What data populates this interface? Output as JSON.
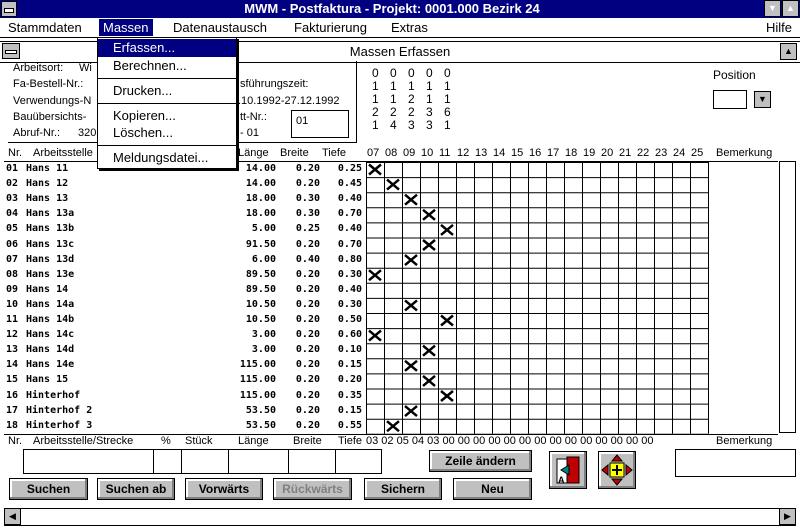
{
  "window": {
    "title": "MWM - Postfaktura  -  Projekt: 0001.000 Bezirk 24"
  },
  "menubar": {
    "items": [
      {
        "label": "Stammdaten"
      },
      {
        "label": "Massen"
      },
      {
        "label": "Datenaustausch"
      },
      {
        "label": "Fakturierung"
      },
      {
        "label": "Extras"
      }
    ],
    "help": "Hilfe"
  },
  "menu_massen": {
    "items": [
      "Erfassen...",
      "Berechnen...",
      "Drucken...",
      "Kopieren...",
      "Löschen...",
      "Meldungsdatei..."
    ]
  },
  "child": {
    "title": "Massen Erfassen"
  },
  "info": {
    "arbeitsort_label": "Arbeitsort:",
    "arbeitsort_value": "Wi",
    "fabestell_label": "Fa-Bestell-Nr.:",
    "verwendung_label": "Verwendungs-N",
    "bauuebersicht_label": "Bauübersichts-",
    "abruf_label": "Abruf-Nr.:",
    "abruf_value": "320",
    "ausfuehrung_label": "sführungszeit:",
    "ausfuehrung_value": ".10.1992-27.12.1992",
    "blatt_label": "tt-Nr.:",
    "blatt_value": "- 01",
    "blatt_box": "01"
  },
  "digits": {
    "rows": [
      [
        "0",
        "0",
        "0",
        "0",
        "0"
      ],
      [
        "1",
        "1",
        "1",
        "1",
        "1"
      ],
      [
        "1",
        "1",
        "2",
        "1",
        "1"
      ],
      [
        "2",
        "2",
        "2",
        "3",
        "6"
      ],
      [
        "1",
        "4",
        "3",
        "3",
        "1"
      ]
    ]
  },
  "position": {
    "label": "Position",
    "value": ""
  },
  "table": {
    "headers": {
      "nr": "Nr.",
      "arbeitsstelle": "Arbeitsstelle",
      "laenge": "Länge",
      "breite": "Breite",
      "tiefe": "Tiefe",
      "bemerkung": "Bemerkung"
    },
    "day_columns": [
      "07",
      "08",
      "09",
      "10",
      "11",
      "12",
      "13",
      "14",
      "15",
      "16",
      "17",
      "18",
      "19",
      "20",
      "21",
      "22",
      "23",
      "24",
      "25"
    ],
    "rows": [
      {
        "nr": "01",
        "name": "Hans 11",
        "laenge": "14.00",
        "breite": "0.20",
        "tiefe": "0.25",
        "mark": 0
      },
      {
        "nr": "02",
        "name": "Hans 12",
        "laenge": "14.00",
        "breite": "0.20",
        "tiefe": "0.45",
        "mark": 1
      },
      {
        "nr": "03",
        "name": "Hans 13",
        "laenge": "18.00",
        "breite": "0.30",
        "tiefe": "0.40",
        "mark": 2
      },
      {
        "nr": "04",
        "name": "Hans 13a",
        "laenge": "18.00",
        "breite": "0.30",
        "tiefe": "0.70",
        "mark": 3
      },
      {
        "nr": "05",
        "name": "Hans 13b",
        "laenge": "5.00",
        "breite": "0.25",
        "tiefe": "0.40",
        "mark": 4
      },
      {
        "nr": "06",
        "name": "Hans 13c",
        "laenge": "91.50",
        "breite": "0.20",
        "tiefe": "0.70",
        "mark": 3
      },
      {
        "nr": "07",
        "name": "Hans 13d",
        "laenge": "6.00",
        "breite": "0.40",
        "tiefe": "0.80",
        "mark": 2
      },
      {
        "nr": "08",
        "name": "Hans 13e",
        "laenge": "89.50",
        "breite": "0.20",
        "tiefe": "0.30",
        "mark": 0
      },
      {
        "nr": "09",
        "name": "Hans 14",
        "laenge": "89.50",
        "breite": "0.20",
        "tiefe": "0.40",
        "mark": -1
      },
      {
        "nr": "10",
        "name": "Hans 14a",
        "laenge": "10.50",
        "breite": "0.20",
        "tiefe": "0.30",
        "mark": 2
      },
      {
        "nr": "11",
        "name": "Hans 14b",
        "laenge": "10.50",
        "breite": "0.20",
        "tiefe": "0.50",
        "mark": 4
      },
      {
        "nr": "12",
        "name": "Hans 14c",
        "laenge": "3.00",
        "breite": "0.20",
        "tiefe": "0.60",
        "mark": 0
      },
      {
        "nr": "13",
        "name": "Hans 14d",
        "laenge": "3.00",
        "breite": "0.20",
        "tiefe": "0.10",
        "mark": 3
      },
      {
        "nr": "14",
        "name": "Hans 14e",
        "laenge": "115.00",
        "breite": "0.20",
        "tiefe": "0.15",
        "mark": 2
      },
      {
        "nr": "15",
        "name": "Hans 15",
        "laenge": "115.00",
        "breite": "0.20",
        "tiefe": "0.20",
        "mark": 3
      },
      {
        "nr": "16",
        "name": "Hinterhof",
        "laenge": "115.00",
        "breite": "0.20",
        "tiefe": "0.35",
        "mark": 4
      },
      {
        "nr": "17",
        "name": "Hinterhof 2",
        "laenge": "53.50",
        "breite": "0.20",
        "tiefe": "0.15",
        "mark": 2
      },
      {
        "nr": "18",
        "name": "Hinterhof 3",
        "laenge": "53.50",
        "breite": "0.20",
        "tiefe": "0.55",
        "mark": 1
      }
    ]
  },
  "edit": {
    "headers": {
      "nr": "Nr.",
      "arbeitsstelle": "Arbeitsstelle/Strecke",
      "pct": "%",
      "stueck": "Stück",
      "laenge": "Länge",
      "breite": "Breite",
      "tiefe": "Tiefe",
      "bemerkung": "Bemerkung"
    },
    "day_values": "03 02 05 04 03 00 00 00 00 00 00 00 00 00 00 00 00 00 00"
  },
  "buttons": {
    "zeile_aendern": "Zeile ändern",
    "suchen": "Suchen",
    "suchen_ab": "Suchen ab",
    "vorwaerts": "Vorwärts",
    "rueckwaerts": "Rückwärts",
    "sichern": "Sichern",
    "neu": "Neu"
  }
}
